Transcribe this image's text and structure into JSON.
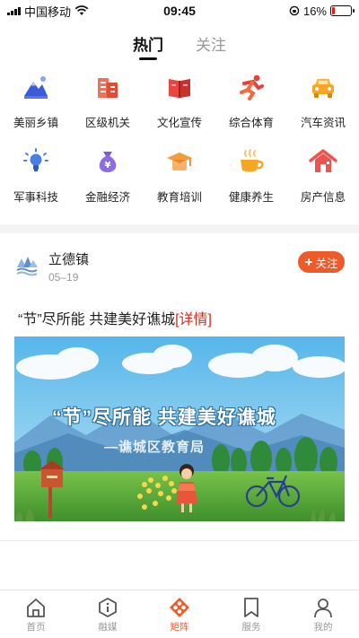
{
  "status_bar": {
    "carrier": "中国移动",
    "time": "09:45",
    "battery": "16%",
    "battery_level": 0.16
  },
  "top_tabs": [
    {
      "label": "热门",
      "active": true
    },
    {
      "label": "关注",
      "active": false
    }
  ],
  "categories": [
    {
      "label": "美丽乡镇",
      "icon": "mountain-icon"
    },
    {
      "label": "区级机关",
      "icon": "building-icon"
    },
    {
      "label": "文化宣传",
      "icon": "book-icon"
    },
    {
      "label": "综合体育",
      "icon": "runner-icon"
    },
    {
      "label": "汽车资讯",
      "icon": "car-icon"
    },
    {
      "label": "军事科技",
      "icon": "lightbulb-icon"
    },
    {
      "label": "金融经济",
      "icon": "money-bag-icon"
    },
    {
      "label": "教育培训",
      "icon": "graduation-cap-icon"
    },
    {
      "label": "健康养生",
      "icon": "tea-cup-icon"
    },
    {
      "label": "房产信息",
      "icon": "house-icon"
    }
  ],
  "post": {
    "author": "立德镇",
    "date": "05–19",
    "follow_label": "关注",
    "title": "“节”尽所能 共建美好谯城",
    "detail_link": "[详情]",
    "image_line1": "“节”尽所能 共建美好谯城",
    "image_line2": "—谯城区教育局"
  },
  "bottom_nav": [
    {
      "label": "首页",
      "icon": "home-icon",
      "active": false
    },
    {
      "label": "融媒",
      "icon": "media-icon",
      "active": false
    },
    {
      "label": "矩阵",
      "icon": "matrix-icon",
      "active": true
    },
    {
      "label": "服务",
      "icon": "bookmark-icon",
      "active": false
    },
    {
      "label": "我的",
      "icon": "user-icon",
      "active": false
    }
  ],
  "colors": {
    "accent": "#f05a28",
    "detail_link": "#d22d1c"
  }
}
